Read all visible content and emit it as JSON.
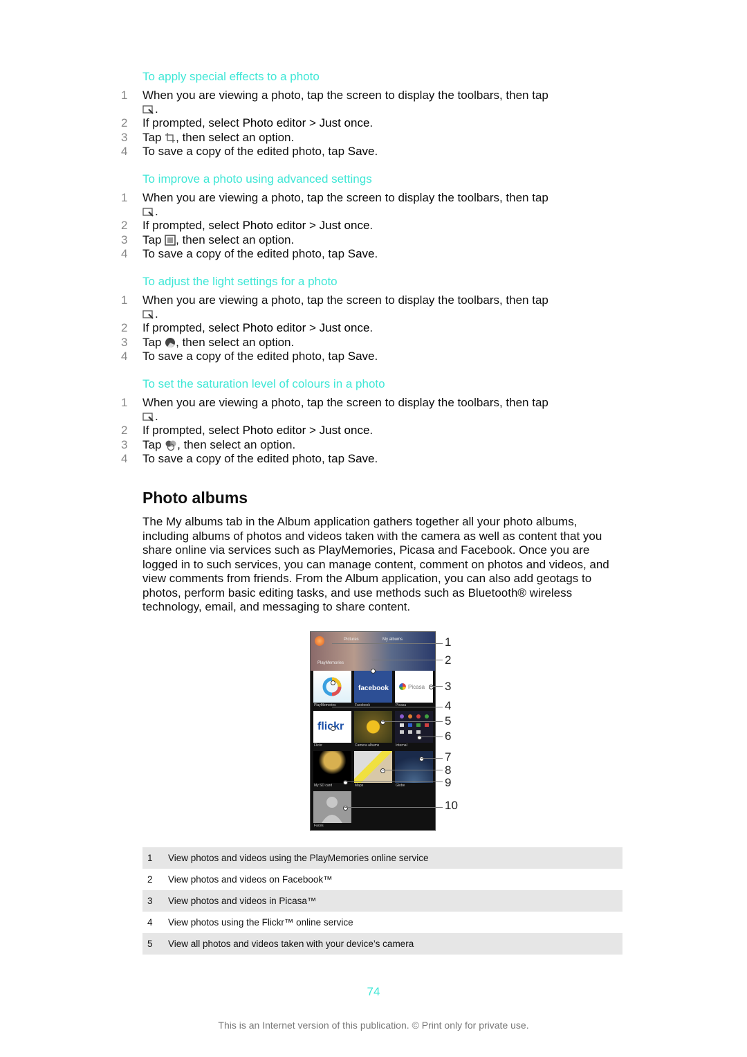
{
  "sections": [
    {
      "title": "To apply special effects to a photo",
      "steps": [
        {
          "num": "1",
          "text": "When you are viewing a photo, tap the screen to display the toolbars, then tap",
          "cont_icon": "edit-photo-icon"
        },
        {
          "num": "2",
          "pre": "If prompted, select ",
          "b1": "Photo editor",
          "mid": " > ",
          "b2": "Just once",
          "post": "."
        },
        {
          "num": "3",
          "pre": "Tap ",
          "icon": "crop-icon",
          "post": ", then select an option."
        },
        {
          "num": "4",
          "pre": "To save a copy of the edited photo, tap ",
          "b1": "Save",
          "post": "."
        }
      ]
    },
    {
      "title": "To improve a photo using advanced settings",
      "steps": [
        {
          "num": "1",
          "text": "When you are viewing a photo, tap the screen to display the toolbars, then tap",
          "cont_icon": "edit-photo-icon"
        },
        {
          "num": "2",
          "pre": "If prompted, select ",
          "b1": "Photo editor",
          "mid": " > ",
          "b2": "Just once",
          "post": "."
        },
        {
          "num": "3",
          "pre": "Tap ",
          "icon": "frame-icon",
          "post": ", then select an option."
        },
        {
          "num": "4",
          "pre": "To save a copy of the edited photo, tap ",
          "b1": "Save",
          "post": "."
        }
      ]
    },
    {
      "title": "To adjust the light settings for a photo",
      "steps": [
        {
          "num": "1",
          "text": "When you are viewing a photo, tap the screen to display the toolbars, then tap",
          "cont_icon": "edit-photo-icon"
        },
        {
          "num": "2",
          "pre": "If prompted, select ",
          "b1": "Photo editor",
          "mid": " > ",
          "b2": "Just once",
          "post": "."
        },
        {
          "num": "3",
          "pre": "Tap ",
          "icon": "light-icon",
          "post": ", then select an option."
        },
        {
          "num": "4",
          "pre": "To save a copy of the edited photo, tap ",
          "b1": "Save",
          "post": "."
        }
      ]
    },
    {
      "title": "To set the saturation level of colours in a photo",
      "steps": [
        {
          "num": "1",
          "text": "When you are viewing a photo, tap the screen to display the toolbars, then tap",
          "cont_icon": "edit-photo-icon"
        },
        {
          "num": "2",
          "pre": "If prompted, select ",
          "b1": "Photo editor",
          "mid": " > ",
          "b2": "Just once",
          "post": "."
        },
        {
          "num": "3",
          "pre": "Tap ",
          "icon": "saturation-icon",
          "post": ", then select an option."
        },
        {
          "num": "4",
          "pre": "To save a copy of the edited photo, tap ",
          "b1": "Save",
          "post": "."
        }
      ]
    }
  ],
  "period": ".",
  "heading": "Photo albums",
  "paragraph": "The My albums tab in the Album application gathers together all your photo albums, including albums of photos and videos taken with the camera as well as content that you share online via services such as PlayMemories, Picasa and Facebook. Once you are logged in to such services, you can manage content, comment on photos and videos, and view comments from friends. From the Album application, you can also add geotags to photos, perform basic editing tasks, and use methods such as Bluetooth® wireless technology, email, and messaging to share content.",
  "phone": {
    "tabs": [
      "Pictures",
      "My albums"
    ],
    "section_label": "PlayMemories",
    "tiles": [
      {
        "label": "PlayMemories",
        "brand": ""
      },
      {
        "label": "Facebook",
        "brand": "facebook"
      },
      {
        "label": "Picasa",
        "brand": "Picasa"
      },
      {
        "label": "Flickr",
        "brand": "flickr"
      },
      {
        "label": "Camera albums",
        "brand": ""
      },
      {
        "label": "Internal",
        "brand": ""
      },
      {
        "label": "My SD card",
        "brand": ""
      },
      {
        "label": "Maps",
        "brand": ""
      },
      {
        "label": "Globe",
        "brand": ""
      },
      {
        "label": "Faces",
        "brand": ""
      }
    ],
    "callouts": [
      "1",
      "2",
      "3",
      "4",
      "5",
      "6",
      "7",
      "8",
      "9",
      "10"
    ]
  },
  "legend": [
    {
      "num": "1",
      "text": "View photos and videos using the PlayMemories online service"
    },
    {
      "num": "2",
      "text": "View photos and videos on Facebook™"
    },
    {
      "num": "3",
      "text": "View photos and videos in Picasa™"
    },
    {
      "num": "4",
      "text": "View photos using the Flickr™ online service"
    },
    {
      "num": "5",
      "text": "View all photos and videos taken with your device’s camera"
    }
  ],
  "page_number": "74",
  "footer": "This is an Internet version of this publication. © Print only for private use.",
  "colors": {
    "accent": "#3fe7d6",
    "row_shade": "#e6e6e6"
  }
}
